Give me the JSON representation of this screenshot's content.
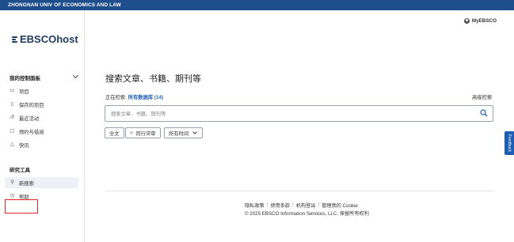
{
  "header": {
    "institution": "ZHONGNAN UNIV OF ECONOMICS AND LAW",
    "account_label": "MyEBSCO"
  },
  "sidebar": {
    "logo_text": "EBSCOhost",
    "dashboard_title": "我的控制面板",
    "dashboard_items": [
      {
        "label": "项目",
        "icon": "file-icon"
      },
      {
        "label": "保存的项目",
        "icon": "bookmark-icon"
      },
      {
        "label": "最近活动",
        "icon": "history-icon"
      },
      {
        "label": "预约与借阅",
        "icon": "reserve-icon"
      },
      {
        "label": "快讯",
        "icon": "bell-icon"
      }
    ],
    "tools_title": "研究工具",
    "tools_items": [
      {
        "label": "新搜索",
        "icon": "search-icon",
        "active": true
      },
      {
        "label": "帮助",
        "icon": "help-icon",
        "active": false
      }
    ]
  },
  "main": {
    "title": "搜索文章、书籍、期刊等",
    "searching_prefix": "正在检索:",
    "searching_db": "所有数据库 (14)",
    "advanced_search": "高级检索",
    "search_placeholder": "搜索文章、书籍、期刊等",
    "filters": {
      "fulltext": "全文",
      "peer_reviewed": "同行评审",
      "time": "所有时间"
    }
  },
  "footer": {
    "links": [
      "隐私政策",
      "使用条款",
      "机构登出",
      "管理我的 Cookie"
    ],
    "copyright": "© 2025 EBSCO Information Services, LLC. 保留所有权利"
  },
  "feedback_label": "Feedback",
  "colors": {
    "topbar": "#1f4e8c",
    "link": "#1f5fb3",
    "highlight": "#e02626"
  }
}
